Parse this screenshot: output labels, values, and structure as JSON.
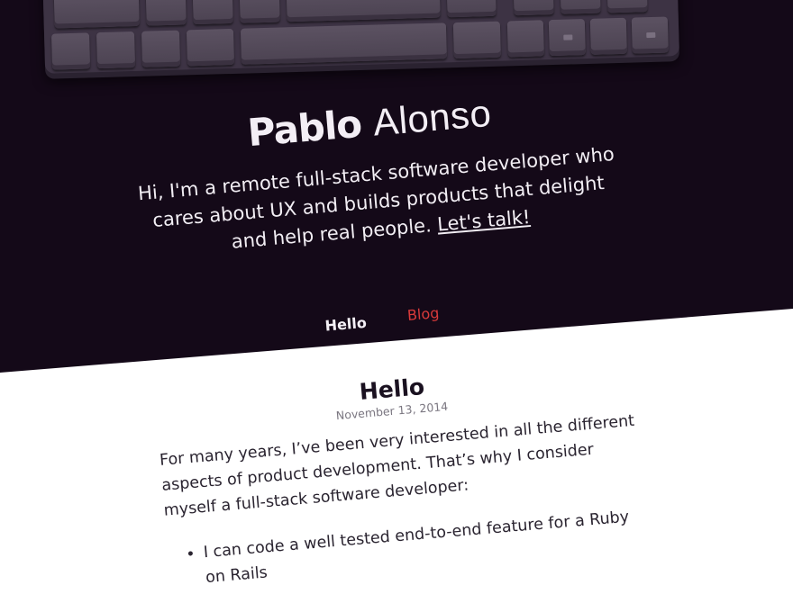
{
  "site": {
    "name_first": "Pablo",
    "name_last": "Alonso",
    "tagline": "Hi, I'm a remote full-stack software developer who cares about UX and builds products that delight and help real people.",
    "tagline_link": "Let's talk!"
  },
  "nav": {
    "items": [
      {
        "label": "Hello",
        "active": true
      },
      {
        "label": "Blog",
        "active": false
      }
    ]
  },
  "post": {
    "title": "Hello",
    "date": "November 13, 2014",
    "paragraph": "For many years, I’ve been very interested in all the different aspects of product development. That’s why I consider myself a full-stack software developer:",
    "bullets": [
      "I can code a well tested end-to-end feature for a Ruby on Rails"
    ]
  },
  "colors": {
    "hero_bg": "#140918",
    "nav_link": "#d93a3a",
    "text_dark": "#2a2430"
  }
}
